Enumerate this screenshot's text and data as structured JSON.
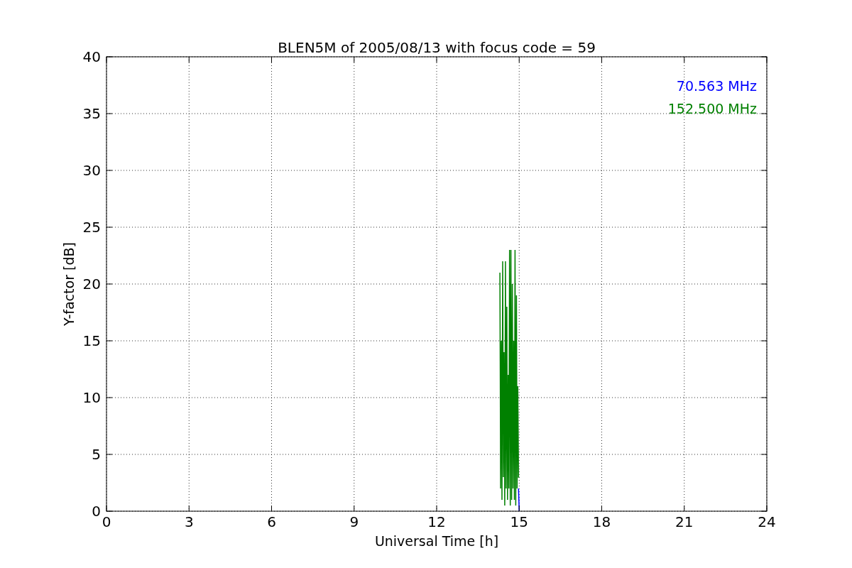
{
  "chart_data": {
    "type": "line",
    "title": "BLEN5M of 2005/08/13 with focus code = 59",
    "xlabel": "Universal Time [h]",
    "ylabel": "Y-factor [dB]",
    "x": [
      14.3,
      14.325,
      14.35,
      14.375,
      14.4,
      14.425,
      14.45,
      14.475,
      14.5,
      14.525,
      14.55,
      14.575,
      14.6,
      14.625,
      14.65,
      14.675,
      14.7,
      14.725,
      14.75,
      14.775,
      14.8,
      14.825,
      14.85,
      14.875,
      14.9,
      14.925,
      14.95,
      14.975,
      15.0
    ],
    "series": [
      {
        "name": "70.563 MHz",
        "color": "#0000ff",
        "values": [
          null,
          null,
          null,
          null,
          null,
          null,
          null,
          null,
          null,
          null,
          null,
          null,
          null,
          null,
          null,
          null,
          null,
          null,
          null,
          null,
          null,
          null,
          null,
          null,
          null,
          null,
          null,
          2,
          0
        ]
      },
      {
        "name": "152.500 MHz",
        "color": "#008000",
        "values": [
          21,
          2,
          15,
          1,
          22,
          3,
          14,
          0.5,
          22,
          2,
          18,
          1,
          12,
          2,
          23,
          0.5,
          23,
          1,
          20,
          2,
          15,
          1,
          23,
          0.5,
          19,
          2,
          11,
          3,
          3
        ]
      }
    ],
    "grid": true,
    "xlim": [
      0,
      24
    ],
    "ylim": [
      0,
      40
    ],
    "xticks": [
      0,
      3,
      6,
      9,
      12,
      15,
      18,
      21,
      24
    ],
    "yticks": [
      0,
      5,
      10,
      15,
      20,
      25,
      30,
      35,
      40
    ]
  }
}
